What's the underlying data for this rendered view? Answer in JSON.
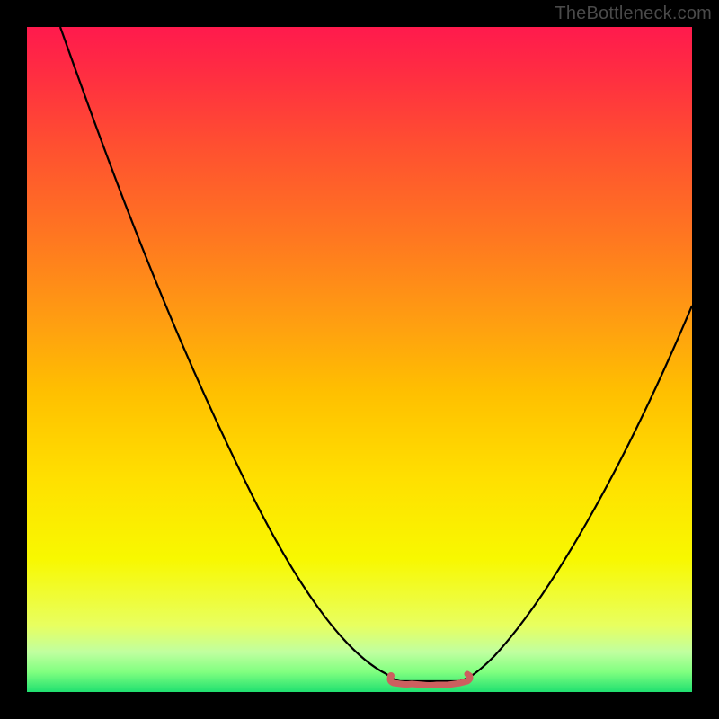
{
  "watermark": "TheBottleneck.com",
  "colors": {
    "background": "#000000",
    "gradient_top": "#ff1a4d",
    "gradient_bottom": "#20e070",
    "curve": "#000000",
    "bottom_mark": "#cc5f5f",
    "watermark_text": "#4a4a4a"
  },
  "chart_data": {
    "type": "line",
    "title": "",
    "xlabel": "",
    "ylabel": "",
    "xlim": [
      0,
      100
    ],
    "ylim": [
      0,
      100
    ],
    "series": [
      {
        "name": "bottleneck-curve",
        "x": [
          5,
          10,
          15,
          20,
          25,
          30,
          35,
          40,
          45,
          50,
          53,
          55,
          58,
          60,
          62,
          64,
          66,
          70,
          75,
          80,
          85,
          90,
          95,
          100
        ],
        "values": [
          100,
          89,
          78,
          67,
          56,
          45,
          35,
          27,
          19,
          12,
          8,
          4,
          2,
          2,
          2,
          2,
          4,
          8,
          15,
          23,
          31,
          40,
          49,
          58
        ]
      }
    ],
    "annotations": [
      {
        "name": "flat-bottom-segment",
        "x_start": 55,
        "x_end": 66,
        "y": 2,
        "color": "#cc5f5f"
      }
    ],
    "grid": false,
    "legend": false
  }
}
